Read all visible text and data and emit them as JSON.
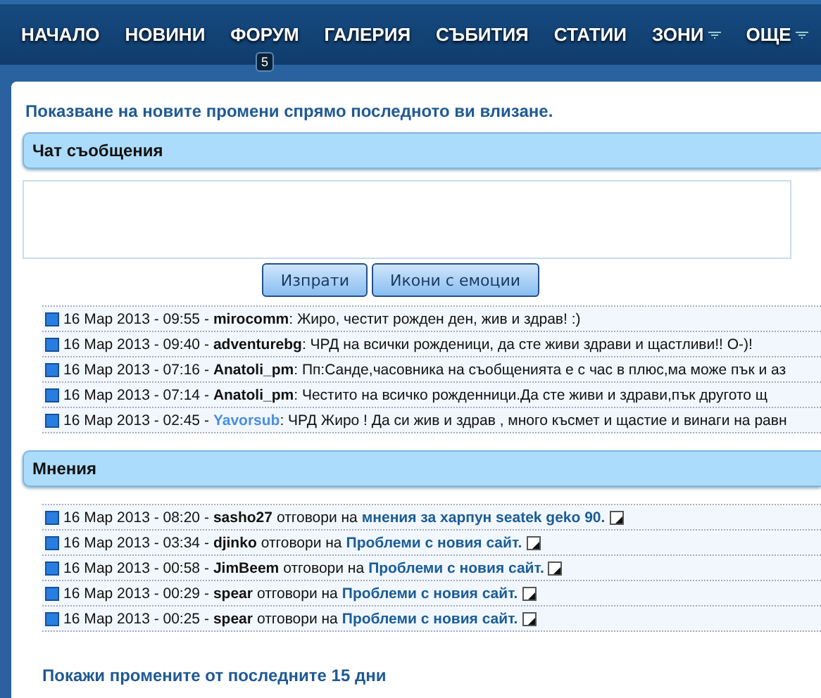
{
  "nav": [
    {
      "label": "НАЧАЛО",
      "has_menu": false
    },
    {
      "label": "НОВИНИ",
      "has_menu": false
    },
    {
      "label": "ФОРУМ",
      "has_menu": false,
      "badge": "5"
    },
    {
      "label": "ГАЛЕРИЯ",
      "has_menu": false
    },
    {
      "label": "СЪБИТИЯ",
      "has_menu": false
    },
    {
      "label": "СТАТИИ",
      "has_menu": false
    },
    {
      "label": "ЗОНИ",
      "has_menu": true
    },
    {
      "label": "ОЩЕ",
      "has_menu": true
    }
  ],
  "intro": "Показване на новите промени спрямо последното ви влизане.",
  "chat": {
    "title": "Чат съобщения",
    "buttons": [
      "Изпрати",
      "Икони с емоции"
    ],
    "messages": [
      {
        "time": "16 Мар 2013 - 09:55 -",
        "user": "mirocomm",
        "highlighted": false,
        "text": ": Жиро, честит рожден ден, жив и здрав! :)"
      },
      {
        "time": "16 Мар 2013 - 09:40 -",
        "user": "adventurebg",
        "highlighted": false,
        "text": ": ЧРД на всички рожденици, да сте живи здрави и щастливи!! O-)!"
      },
      {
        "time": "16 Мар 2013 - 07:16 -",
        "user": "Anatoli_pm",
        "highlighted": false,
        "text": ": Пп:Санде,часовника на съобщенията е с час в плюс,ма може пък и аз"
      },
      {
        "time": "16 Мар 2013 - 07:14 -",
        "user": "Anatoli_pm",
        "highlighted": false,
        "text": ": Честито на всичко рожденници.Да сте живи и здрави,пък другото щ"
      },
      {
        "time": "16 Мар 2013 - 02:45 -",
        "user": "Yavorsub",
        "highlighted": true,
        "text": ": ЧРД Жиро ! Да си жив и здрав , много късмет и щастие и винаги на равн"
      }
    ]
  },
  "opinions": {
    "title": "Мнения",
    "items": [
      {
        "time": "16 Мар 2013 - 08:20 -",
        "user": "sasho27",
        "action": "отговори на",
        "topic": "мнения за харпун seatek geko 90."
      },
      {
        "time": "16 Мар 2013 - 03:34 -",
        "user": "djinko",
        "action": "отговори на",
        "topic": "Проблеми с новия сайт."
      },
      {
        "time": "16 Мар 2013 - 00:58 -",
        "user": "JimBeem",
        "action": "отговори на",
        "topic": "Проблеми с новия сайт."
      },
      {
        "time": "16 Мар 2013 - 00:29 -",
        "user": "spear",
        "action": "отговори на",
        "topic": "Проблеми с новия сайт."
      },
      {
        "time": "16 Мар 2013 - 00:25 -",
        "user": "spear",
        "action": "отговори на",
        "topic": "Проблеми с новия сайт."
      }
    ]
  },
  "footer_link": "Покажи промените от последните 15 дни"
}
